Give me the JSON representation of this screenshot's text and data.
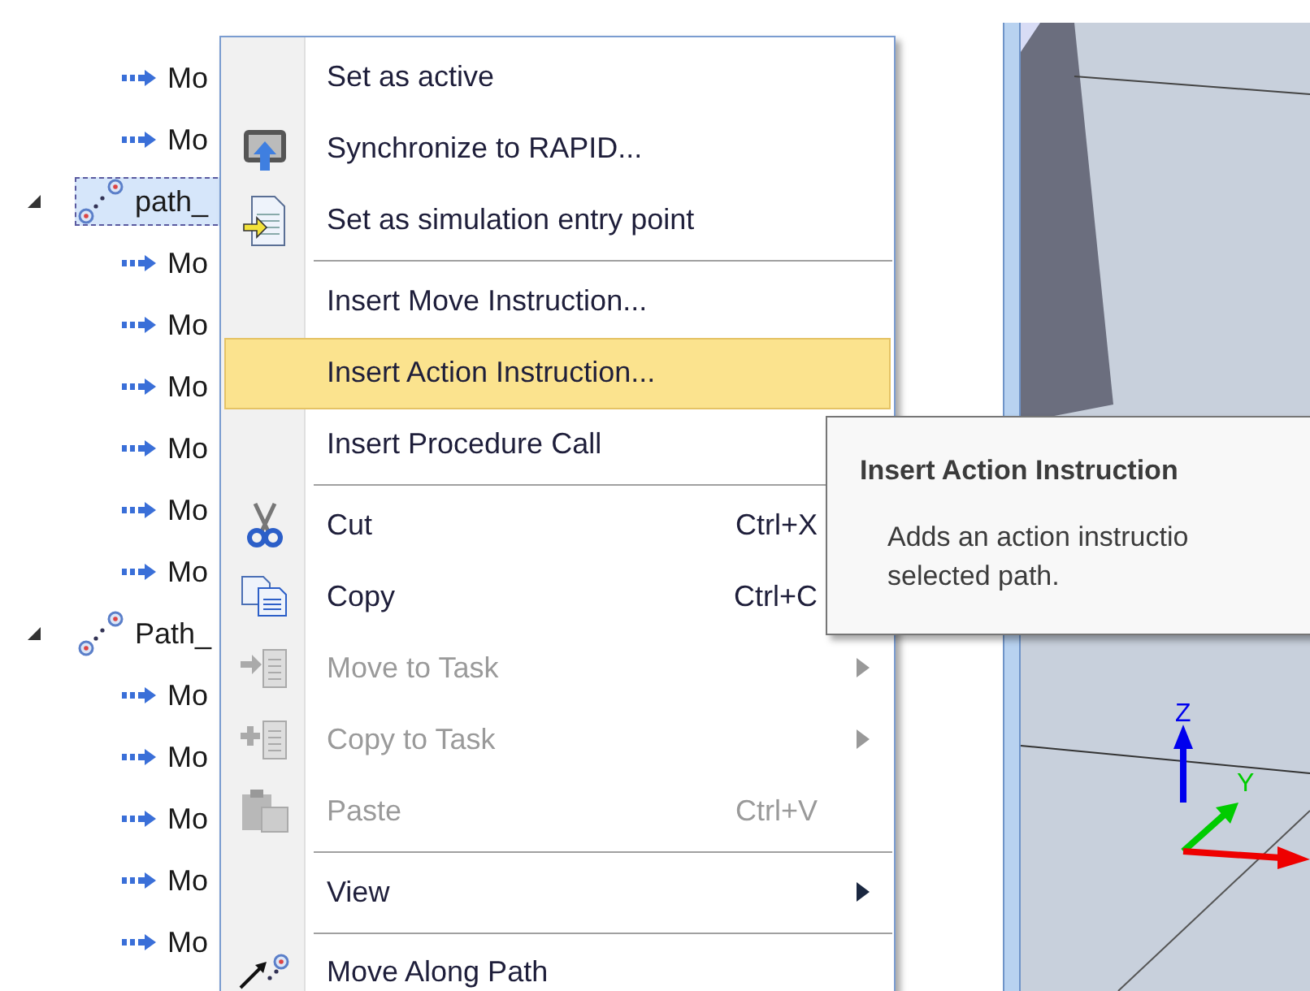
{
  "tree": [
    {
      "label": "Mo",
      "kind": "move",
      "selected": false
    },
    {
      "label": "Mo",
      "kind": "move",
      "selected": false
    },
    {
      "label": "path_",
      "kind": "path",
      "selected": true,
      "expanded": true,
      "children": [
        {
          "label": "Mo",
          "kind": "move",
          "selected": false
        },
        {
          "label": "Mo",
          "kind": "move",
          "selected": false
        },
        {
          "label": "Mo",
          "kind": "move",
          "selected": false
        },
        {
          "label": "Mo",
          "kind": "move",
          "selected": false
        },
        {
          "label": "Mo",
          "kind": "move",
          "selected": false
        },
        {
          "label": "Mo",
          "kind": "move",
          "selected": false
        }
      ]
    },
    {
      "label": "Path_",
      "kind": "path",
      "selected": false,
      "expanded": true,
      "children": [
        {
          "label": "Mo",
          "kind": "move",
          "selected": false
        },
        {
          "label": "Mo",
          "kind": "move",
          "selected": false
        },
        {
          "label": "Mo",
          "kind": "move",
          "selected": false
        },
        {
          "label": "Mo",
          "kind": "move",
          "selected": false
        },
        {
          "label": "Mo",
          "kind": "move",
          "selected": false
        }
      ]
    }
  ],
  "context_menu": [
    {
      "kind": "item",
      "label": "Set as active",
      "selected": false,
      "disabled": false
    },
    {
      "kind": "item",
      "label": "Synchronize to RAPID...",
      "selected": false,
      "disabled": false
    },
    {
      "kind": "item",
      "label": "Set as simulation entry point",
      "selected": false,
      "disabled": false
    },
    {
      "kind": "separator"
    },
    {
      "kind": "item",
      "label": "Insert Move Instruction...",
      "selected": false,
      "disabled": false
    },
    {
      "kind": "item",
      "label": "Insert Action Instruction...",
      "selected": true,
      "disabled": false
    },
    {
      "kind": "item",
      "label": "Insert Procedure Call",
      "selected": false,
      "disabled": false
    },
    {
      "kind": "separator"
    },
    {
      "kind": "item",
      "label": "Cut",
      "shortcut": "Ctrl+X",
      "selected": false,
      "disabled": false
    },
    {
      "kind": "item",
      "label": "Copy",
      "shortcut": "Ctrl+C",
      "selected": false,
      "disabled": false
    },
    {
      "kind": "item",
      "label": "Move to Task",
      "submenu": true,
      "selected": false,
      "disabled": true
    },
    {
      "kind": "item",
      "label": "Copy to Task",
      "submenu": true,
      "selected": false,
      "disabled": true
    },
    {
      "kind": "item",
      "label": "Paste",
      "shortcut": "Ctrl+V",
      "selected": false,
      "disabled": true
    },
    {
      "kind": "separator"
    },
    {
      "kind": "item",
      "label": "View",
      "submenu": true,
      "selected": false,
      "disabled": false
    },
    {
      "kind": "separator"
    },
    {
      "kind": "item",
      "label": "Move Along Path",
      "selected": false,
      "disabled": false
    }
  ],
  "tooltip": {
    "title": "Insert Action Instruction",
    "description_lines": [
      "Adds an action instructio",
      "selected path."
    ]
  },
  "viewport": {
    "axis_labels": [
      "Z",
      "Y"
    ]
  }
}
